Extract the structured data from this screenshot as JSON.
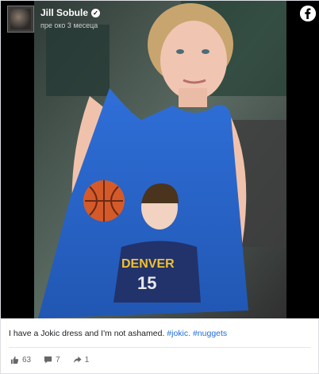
{
  "post": {
    "author_name": "Jill Sobule",
    "timestamp": "пре око 3 месеца",
    "caption_text": "I have a Jokic dress and I'm not ashamed.",
    "hashtags": [
      "#jokic.",
      "#nuggets"
    ],
    "reactions": {
      "likes": "63",
      "comments": "7",
      "shares": "1"
    }
  },
  "icons": [
    "verified-badge-icon",
    "facebook-logo-icon",
    "like-icon",
    "comment-icon",
    "share-icon"
  ],
  "colors": {
    "background": "#ffffff",
    "media_bg": "#000000",
    "hashtag": "#216fdb",
    "text": "#1c1e21",
    "meta": "#65676b"
  }
}
